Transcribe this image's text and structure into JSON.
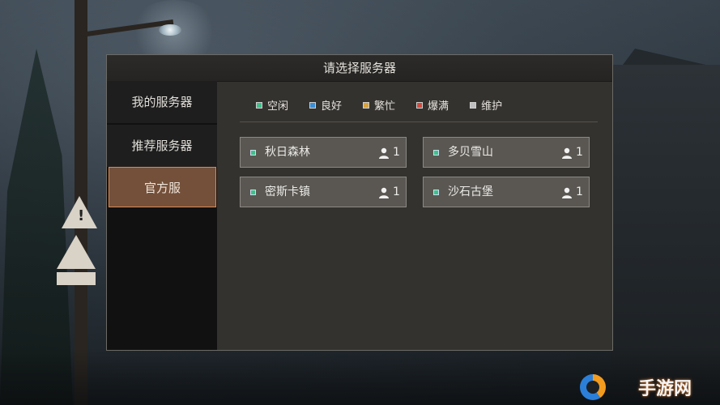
{
  "dialog": {
    "title": "请选择服务器"
  },
  "sidebar": {
    "items": [
      {
        "label": "我的服务器",
        "selected": false
      },
      {
        "label": "推荐服务器",
        "selected": false
      },
      {
        "label": "官方服",
        "selected": true
      }
    ]
  },
  "legend": [
    {
      "label": "空闲",
      "color": "#3fc08a"
    },
    {
      "label": "良好",
      "color": "#3a8fd6"
    },
    {
      "label": "繁忙",
      "color": "#d9a23a"
    },
    {
      "label": "爆满",
      "color": "#d24a3e"
    },
    {
      "label": "维护",
      "color": "#bfbfbf"
    }
  ],
  "servers": [
    {
      "name": "秋日森林",
      "players": "1",
      "status_color": "#3fc08a"
    },
    {
      "name": "多贝雪山",
      "players": "1",
      "status_color": "#3fc08a"
    },
    {
      "name": "密斯卡镇",
      "players": "1",
      "status_color": "#3fc08a"
    },
    {
      "name": "沙石古堡",
      "players": "1",
      "status_color": "#3fc08a"
    }
  ],
  "icons": {
    "player": "user-icon",
    "watermark_logo": "swirl-logo-icon"
  },
  "watermark": {
    "text": "手游网"
  }
}
